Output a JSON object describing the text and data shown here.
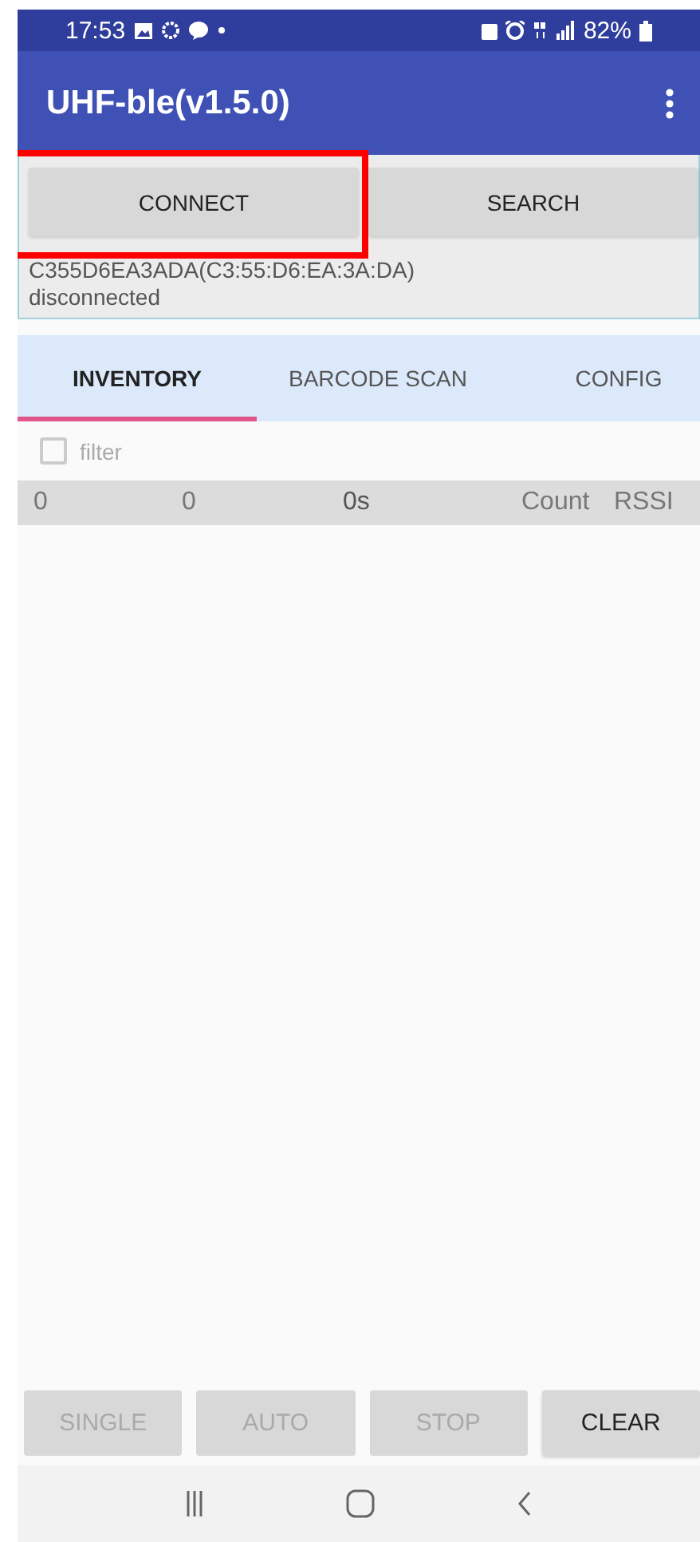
{
  "status_bar": {
    "time": "17:53",
    "battery": "82%"
  },
  "app_bar": {
    "title": "UHF-ble(v1.5.0)"
  },
  "top_buttons": [
    {
      "label": "CONNECT",
      "highlighted": true
    },
    {
      "label": "SEARCH",
      "highlighted": false
    }
  ],
  "device": {
    "name": "C355D6EA3ADA(C3:55:D6:EA:3A:DA)",
    "state": "disconnected"
  },
  "tabs": [
    {
      "label": "INVENTORY",
      "selected": true
    },
    {
      "label": "BARCODE SCAN",
      "selected": false
    },
    {
      "label": "CONFIG",
      "selected": false
    }
  ],
  "filter": {
    "label": "filter",
    "checked": false
  },
  "summary": [
    "0",
    "0",
    "0s",
    "Count",
    "RSSI"
  ],
  "bottom_buttons": [
    {
      "label": "SINGLE",
      "disabled": true
    },
    {
      "label": "AUTO",
      "disabled": true
    },
    {
      "label": "STOP",
      "disabled": true
    },
    {
      "label": "CLEAR",
      "disabled": false
    }
  ]
}
